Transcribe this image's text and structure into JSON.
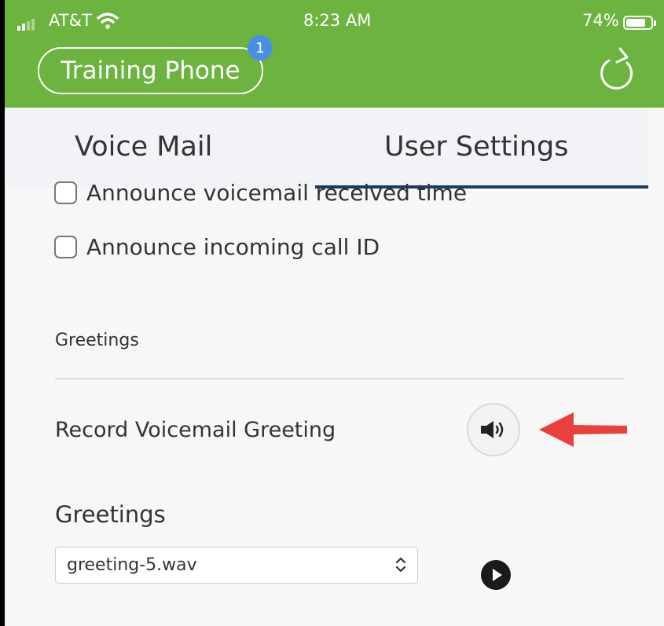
{
  "status_bar": {
    "carrier": "AT&T",
    "time": "8:23 AM",
    "battery_percent": "74%",
    "battery_level": 0.74,
    "icons": [
      "signal-icon",
      "wifi-icon",
      "battery-icon"
    ]
  },
  "header": {
    "phone_label": "Training Phone",
    "badge_count": "1",
    "refresh_icon": "refresh-icon",
    "bg_color": "#6db33f"
  },
  "tabs": [
    {
      "label": "Voice Mail",
      "active": false
    },
    {
      "label": "User Settings",
      "active": true
    }
  ],
  "settings": {
    "checkboxes": [
      {
        "label": "Announce voicemail received time",
        "checked": false
      },
      {
        "label": "Announce incoming call ID",
        "checked": false
      }
    ],
    "section_label": "Greetings",
    "record_label": "Record Voicemail Greeting",
    "record_icon": "speaker-icon",
    "annotation": "red-arrow",
    "greetings_title": "Greetings",
    "greeting_select": {
      "value": "greeting-5.wav",
      "icon": "chevron-updown-icon"
    },
    "play_icon": "play-icon"
  }
}
